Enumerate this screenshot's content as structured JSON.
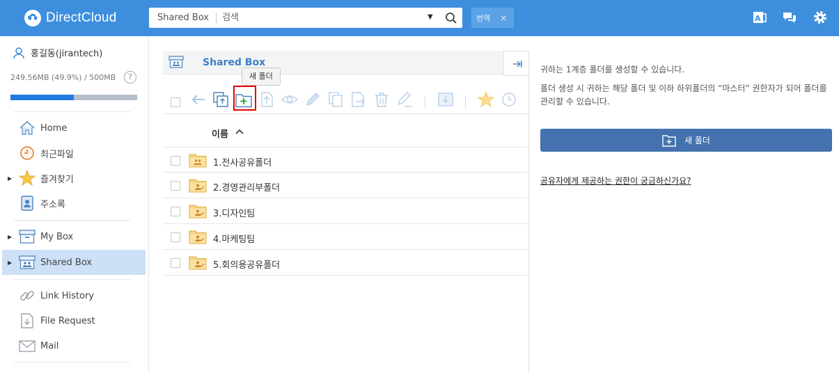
{
  "header": {
    "logo_text": "DirectCloud",
    "search_scope": "Shared Box",
    "search_placeholder": "검색",
    "translate_label": "번역",
    "translate_close": "×"
  },
  "sidebar": {
    "user_name": "홍길동(jirantech)",
    "quota_text": "249.56MB (49.9%) / 500MB",
    "quota_fraction": 0.499,
    "help": "?",
    "items": [
      {
        "label": "Home"
      },
      {
        "label": "최근파일"
      },
      {
        "label": "즐겨찾기"
      },
      {
        "label": "주소록"
      },
      {
        "label": "My Box"
      },
      {
        "label": "Shared Box"
      },
      {
        "label": "Link History"
      },
      {
        "label": "File Request"
      },
      {
        "label": "Mail"
      }
    ]
  },
  "main": {
    "breadcrumb_title": "Shared Box",
    "tooltip": "새 폴더",
    "column_name": "이름",
    "rows": [
      {
        "name": "1.전사공유폴더"
      },
      {
        "name": "2.경영관리부폴더"
      },
      {
        "name": "3.디자인팀"
      },
      {
        "name": "4.마케팅팀"
      },
      {
        "name": "5.회의용공유폴더"
      }
    ]
  },
  "panel": {
    "text1": "귀하는 1계층 폴더를 생성할 수 있습니다.",
    "text2": "폴더 생성 시 귀하는 해당 폴더 및 이하 하위폴더의 “마스터” 권한자가 되어 폴더를 관리할 수 있습니다.",
    "button_label": "새 폴더",
    "link_text": "공유자에게 제공하는 권한이 궁금하신가요?"
  },
  "colors": {
    "header": "#3d8fde",
    "panel_button": "#4472ae",
    "active_nav": "#cde0f8",
    "highlight": "#e60000"
  }
}
